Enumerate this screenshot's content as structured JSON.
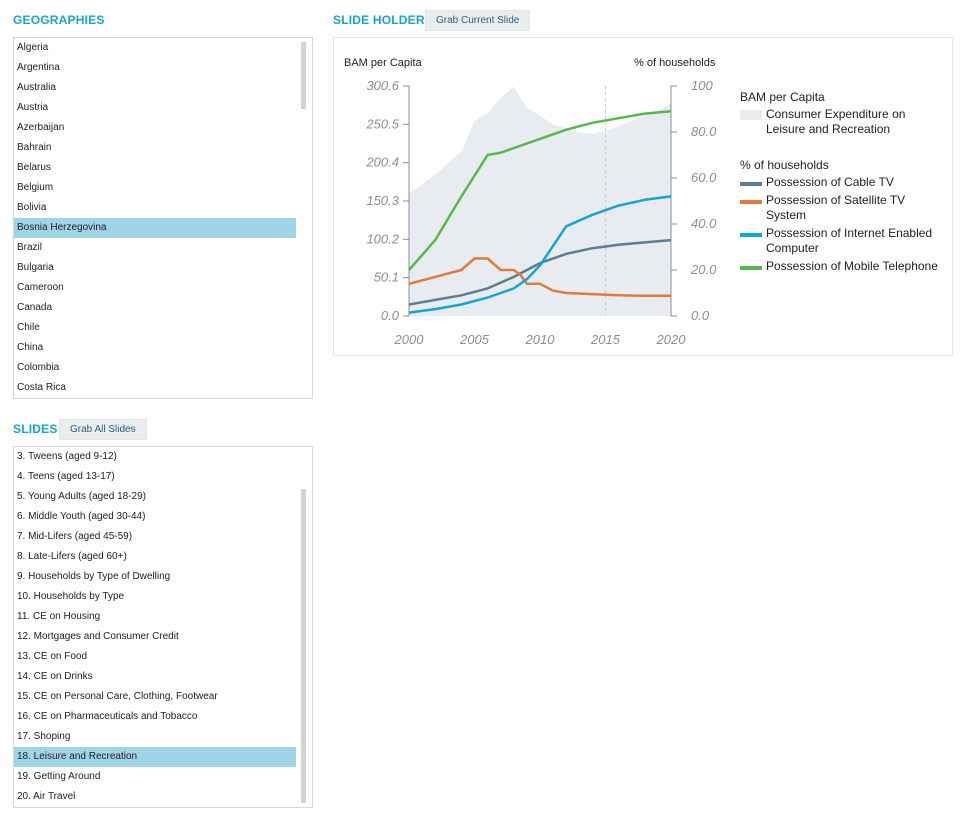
{
  "geographies": {
    "title": "GEOGRAPHIES",
    "items": [
      "Algeria",
      "Argentina",
      "Australia",
      "Austria",
      "Azerbaijan",
      "Bahrain",
      "Belarus",
      "Belgium",
      "Bolivia",
      "Bosnia Herzegovina",
      "Brazil",
      "Bulgaria",
      "Cameroon",
      "Canada",
      "Chile",
      "China",
      "Colombia",
      "Costa Rica"
    ],
    "selected": "Bosnia Herzegovina"
  },
  "slide_holder": {
    "title": "SLIDE HOLDER",
    "grab_button": "Grab Current Slide"
  },
  "slides": {
    "title": "SLIDES",
    "grab_button": "Grab All Slides",
    "items": [
      "3. Tweens (aged 9-12)",
      "4. Teens (aged 13-17)",
      "5. Young Adults (aged 18-29)",
      "6. Middle Youth (aged 30-44)",
      "7. Mid-Lifers (aged 45-59)",
      "8. Late-Lifers (aged 60+)",
      "9. Households by Type of Dwelling",
      "10. Households by Type",
      "11. CE on Housing",
      "12. Mortgages and Consumer Credit",
      "13. CE on Food",
      "14. CE on Drinks",
      "15. CE on Personal Care, Clothing, Footwear",
      "16. CE on Pharmaceuticals and Tobacco",
      "17. Shoping",
      "18. Leisure and Recreation",
      "19. Getting Around",
      "20. Air Travel"
    ],
    "selected": "18. Leisure and Recreation"
  },
  "chart_data": {
    "type": "area",
    "left_axis_title": "BAM per Capita",
    "right_axis_title": "% of households",
    "x_ticks": [
      2000,
      2005,
      2010,
      2015,
      2020
    ],
    "y_left_ticks": [
      "0.0",
      "50.1",
      "100.2",
      "150.3",
      "200.4",
      "250.5",
      "300.6"
    ],
    "y_left_range": [
      0,
      300.6
    ],
    "y_right_ticks": [
      "0.0",
      "20.0",
      "40.0",
      "60.0",
      "80.0",
      "100"
    ],
    "y_right_range": [
      0,
      100
    ],
    "xlim": [
      2000,
      2020
    ],
    "forecast_divider_x": 2015,
    "legend": {
      "left_group_title": "BAM per Capita",
      "right_group_title": "% of households"
    },
    "area_series": {
      "name": "Consumer Expenditure on Leisure and Recreation",
      "color": "#e8ebef",
      "axis": "left",
      "x": [
        2000,
        2002,
        2004,
        2005,
        2006,
        2007,
        2008,
        2009,
        2010,
        2011,
        2012,
        2013,
        2014,
        2015,
        2016,
        2017,
        2018,
        2019,
        2020
      ],
      "y": [
        160,
        185,
        215,
        255,
        265,
        285,
        300,
        272,
        262,
        250,
        246,
        240,
        238,
        242,
        248,
        255,
        262,
        268,
        278
      ]
    },
    "line_series": [
      {
        "name": "Possession of Cable TV",
        "color": "#5a7f95",
        "axis": "right",
        "x": [
          2000,
          2002,
          2004,
          2006,
          2008,
          2010,
          2012,
          2014,
          2016,
          2018,
          2020
        ],
        "y": [
          5,
          7,
          9,
          12,
          17,
          23,
          27,
          29.5,
          31,
          32,
          33
        ]
      },
      {
        "name": "Possession of Satellite TV System",
        "color": "#e07b3c",
        "axis": "right",
        "x": [
          2000,
          2002,
          2004,
          2005,
          2006,
          2007,
          2008,
          2008.5,
          2009,
          2010,
          2011,
          2012,
          2014,
          2016,
          2018,
          2020
        ],
        "y": [
          14,
          17,
          20,
          25,
          25,
          20,
          20,
          18,
          14,
          14,
          11,
          10,
          9.5,
          9,
          8.8,
          8.8
        ]
      },
      {
        "name": "Possession of Internet Enabled Computer",
        "color": "#14a5d6",
        "axis": "right",
        "x": [
          2000,
          2002,
          2004,
          2006,
          2007,
          2008,
          2009,
          2010,
          2012,
          2014,
          2016,
          2018,
          2020
        ],
        "y": [
          1.5,
          3,
          5,
          8,
          10,
          12,
          16,
          22,
          39,
          44,
          48,
          50.5,
          52
        ]
      },
      {
        "name": "Possession of Mobile Telephone",
        "color": "#56b94b",
        "axis": "right",
        "x": [
          2000,
          2002,
          2004,
          2006,
          2007,
          2008,
          2010,
          2012,
          2014,
          2016,
          2018,
          2020
        ],
        "y": [
          20,
          33,
          52,
          70,
          71,
          73,
          77,
          81,
          84,
          86,
          88,
          89
        ]
      }
    ]
  }
}
